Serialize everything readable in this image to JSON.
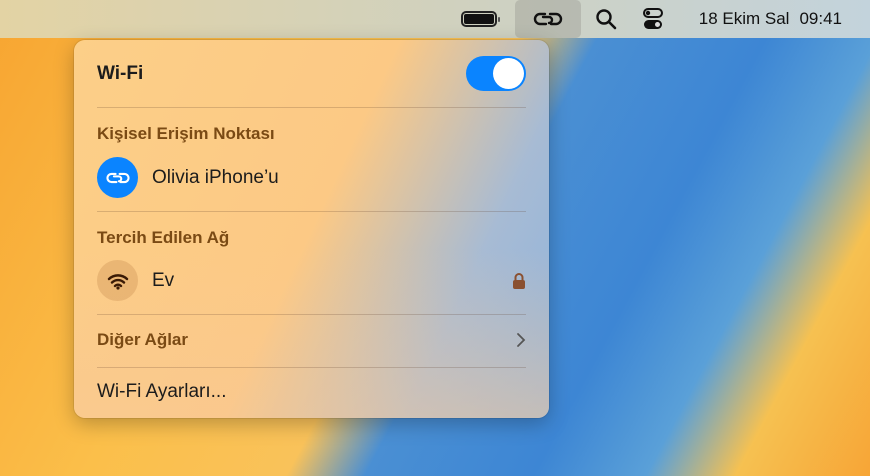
{
  "menubar": {
    "date": "18 Ekim Sal",
    "time": "09:41",
    "icons": [
      "battery-icon",
      "personal-hotspot-icon",
      "search-icon",
      "control-center-icon"
    ]
  },
  "menu": {
    "wifi_label": "Wi-Fi",
    "wifi_on": true,
    "hotspot_header": "Kişisel Erişim Noktası",
    "hotspot_device": "Olivia iPhone’u",
    "preferred_header": "Tercih Edilen Ağ",
    "preferred_network": "Ev",
    "other_networks": "Diğer Ağlar",
    "settings": "Wi-Fi Ayarları..."
  },
  "colors": {
    "accent": "#0a84ff"
  }
}
